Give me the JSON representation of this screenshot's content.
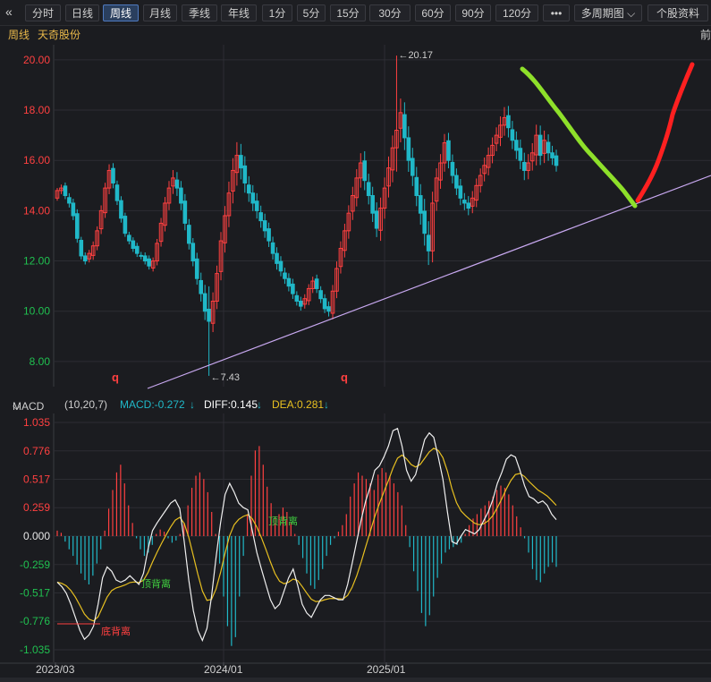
{
  "toolbar": {
    "back_icon": "double-chevron-left-icon",
    "tabs": [
      {
        "label": "分时",
        "active": false
      },
      {
        "label": "日线",
        "active": false
      },
      {
        "label": "周线",
        "active": true
      },
      {
        "label": "月线",
        "active": false
      },
      {
        "label": "季线",
        "active": false
      },
      {
        "label": "年线",
        "active": false
      },
      {
        "label": "1分",
        "active": false
      },
      {
        "label": "5分",
        "active": false
      },
      {
        "label": "15分",
        "active": false
      },
      {
        "label": "30分",
        "active": false
      },
      {
        "label": "60分",
        "active": false
      },
      {
        "label": "90分",
        "active": false
      },
      {
        "label": "120分",
        "active": false
      }
    ],
    "more_label": "•••",
    "multi_period_label": "多周期图",
    "stock_info_label": "个股资料"
  },
  "header": {
    "period": "周线",
    "stock_name": "天奇股份",
    "prev": "前"
  },
  "macd_header": {
    "name": "MACD",
    "params": "(10,20,7)",
    "macd": "MACD:-0.272",
    "diff": "DIFF:0.145",
    "dea": "DEA:0.281",
    "arrow": "↓"
  },
  "colors": {
    "up": "#ff4040",
    "down": "#20b8c8",
    "diff": "#f0f0f0",
    "dea": "#e8c020",
    "trend": "#c8a8f0",
    "green_marker": "#8ee02a",
    "red_marker": "#ff2020",
    "grid": "#2c2d33"
  },
  "chart_data": [
    {
      "type": "candlestick",
      "title": "",
      "yticks": [
        "20.00",
        "18.00",
        "16.00",
        "14.00",
        "12.00",
        "10.00",
        "8.00"
      ],
      "ylim": [
        7.0,
        20.6
      ],
      "grid": true,
      "high_label": "←20.17",
      "low_label": "←7.43",
      "markers": [
        "q",
        "q"
      ],
      "closes": [
        14.8,
        14.9,
        14.6,
        14.3,
        13.8,
        12.9,
        12.2,
        12.0,
        12.3,
        12.6,
        13.2,
        14.0,
        14.9,
        15.6,
        15.1,
        14.4,
        13.7,
        13.1,
        12.8,
        12.5,
        12.3,
        12.2,
        12.0,
        11.8,
        12.0,
        12.7,
        13.5,
        14.3,
        14.9,
        15.3,
        14.9,
        14.3,
        13.5,
        12.7,
        12.0,
        11.3,
        10.7,
        10.0,
        9.6,
        10.4,
        11.5,
        12.8,
        13.8,
        14.7,
        15.6,
        16.2,
        15.7,
        15.1,
        14.7,
        14.3,
        14.0,
        13.6,
        13.2,
        12.8,
        12.3,
        11.9,
        11.6,
        11.3,
        11.0,
        10.7,
        10.4,
        10.2,
        10.5,
        10.9,
        11.2,
        10.9,
        10.5,
        10.1,
        10.0,
        10.8,
        11.7,
        12.5,
        13.2,
        13.9,
        14.6,
        15.3,
        15.9,
        15.2,
        14.6,
        13.9,
        13.3,
        14.1,
        14.9,
        15.7,
        16.5,
        17.2,
        17.9,
        16.9,
        16.0,
        15.4,
        14.6,
        13.9,
        13.1,
        12.4,
        14.3,
        15.3,
        15.9,
        16.7,
        16.0,
        15.4,
        14.9,
        14.5,
        14.3,
        14.1,
        14.5,
        15.0,
        15.4,
        15.8,
        16.2,
        16.6,
        17.0,
        17.4,
        17.7,
        17.3,
        16.8,
        16.4,
        16.0,
        15.6,
        15.9,
        16.3,
        17.0,
        16.2,
        16.8,
        16.3,
        16.1,
        15.8
      ],
      "spans": [
        0.3,
        0.4,
        0.4,
        0.5,
        0.5,
        0.5,
        0.4,
        0.4,
        0.4,
        0.5,
        0.5,
        0.6,
        0.6,
        0.7,
        0.6,
        0.5,
        0.5,
        0.4,
        0.4,
        0.4,
        0.4,
        0.4,
        0.4,
        0.4,
        0.4,
        0.5,
        0.6,
        0.7,
        0.8,
        0.9,
        0.9,
        0.8,
        0.8,
        0.7,
        0.6,
        0.7,
        0.9,
        1.0,
        2.6,
        1.0,
        0.9,
        1.0,
        1.1,
        1.3,
        1.4,
        1.5,
        1.3,
        1.1,
        1.0,
        0.9,
        0.9,
        0.8,
        0.8,
        0.7,
        0.7,
        0.7,
        0.6,
        0.6,
        0.6,
        0.6,
        0.5,
        0.5,
        0.5,
        0.5,
        0.5,
        0.5,
        0.5,
        0.5,
        0.6,
        0.7,
        0.8,
        0.8,
        0.8,
        0.9,
        1.0,
        1.0,
        1.1,
        1.1,
        1.0,
        1.0,
        1.0,
        1.2,
        1.2,
        1.3,
        1.4,
        2.7,
        1.6,
        1.4,
        1.3,
        1.2,
        1.2,
        1.3,
        1.4,
        1.6,
        1.3,
        1.1,
        1.0,
        1.0,
        0.9,
        0.9,
        0.8,
        0.8,
        0.8,
        0.8,
        0.8,
        0.8,
        0.8,
        0.9,
        0.9,
        0.9,
        0.9,
        1.0,
        1.2,
        1.1,
        1.0,
        1.0,
        1.0,
        1.1,
        1.0,
        1.1,
        1.2,
        1.1,
        1.1,
        0.9,
        0.8,
        0.7
      ]
    },
    {
      "type": "macd",
      "params": "(10,20,7)",
      "yticks": [
        "1.035",
        "0.776",
        "0.517",
        "0.259",
        "0.000",
        "-0.259",
        "-0.517",
        "-0.776",
        "-1.035"
      ],
      "ylim": [
        -1.035,
        1.035
      ],
      "xticks": [
        "2023/03",
        "2024/01",
        "2025/01"
      ],
      "annotations": [
        {
          "text": "底背离",
          "color": "#ff4040"
        },
        {
          "text": "顶背离",
          "color": "#40d040"
        },
        {
          "text": "顶背离",
          "color": "#40d040"
        }
      ],
      "hist": [
        0.05,
        0.03,
        -0.05,
        -0.12,
        -0.18,
        -0.26,
        -0.34,
        -0.4,
        -0.44,
        -0.36,
        -0.25,
        -0.12,
        0.05,
        0.25,
        0.42,
        0.58,
        0.65,
        0.48,
        0.28,
        0.12,
        -0.02,
        -0.12,
        -0.18,
        -0.15,
        -0.08,
        0.02,
        0.06,
        0.04,
        -0.02,
        -0.06,
        -0.04,
        0.02,
        0.12,
        0.28,
        0.44,
        0.55,
        0.58,
        0.52,
        0.4,
        0.22,
        0.02,
        -0.25,
        -0.55,
        -0.82,
        -1.0,
        -0.92,
        -0.55,
        -0.18,
        0.2,
        0.55,
        0.78,
        0.82,
        0.65,
        0.45,
        0.3,
        0.18,
        0.2,
        0.26,
        0.22,
        0.12,
        0.02,
        -0.08,
        -0.2,
        -0.34,
        -0.45,
        -0.48,
        -0.4,
        -0.3,
        -0.18,
        -0.08,
        -0.02,
        0.04,
        0.1,
        0.2,
        0.36,
        0.48,
        0.58,
        0.55,
        0.52,
        0.48,
        0.42,
        0.56,
        0.62,
        0.58,
        0.55,
        0.48,
        0.4,
        0.28,
        0.1,
        -0.1,
        -0.32,
        -0.5,
        -0.7,
        -0.82,
        -0.72,
        -0.55,
        -0.38,
        -0.25,
        -0.15,
        -0.12,
        -0.1,
        -0.08,
        -0.06,
        0.02,
        0.1,
        0.16,
        0.2,
        0.25,
        0.28,
        0.32,
        0.36,
        0.42,
        0.46,
        0.44,
        0.38,
        0.28,
        0.18,
        0.08,
        -0.02,
        -0.15,
        -0.3,
        -0.4,
        -0.42,
        -0.34,
        -0.28,
        -0.24,
        -0.28
      ],
      "diff": [
        -0.42,
        -0.46,
        -0.52,
        -0.62,
        -0.74,
        -0.86,
        -0.94,
        -0.9,
        -0.82,
        -0.62,
        -0.38,
        -0.28,
        -0.32,
        -0.4,
        -0.42,
        -0.4,
        -0.36,
        -0.4,
        -0.44,
        -0.34,
        -0.12,
        0.05,
        0.12,
        0.18,
        0.24,
        0.3,
        0.33,
        0.25,
        -0.05,
        -0.4,
        -0.68,
        -0.86,
        -0.95,
        -0.84,
        -0.55,
        -0.2,
        0.12,
        0.38,
        0.48,
        0.4,
        0.3,
        0.26,
        0.24,
        0.05,
        -0.15,
        -0.3,
        -0.44,
        -0.58,
        -0.66,
        -0.62,
        -0.5,
        -0.38,
        -0.3,
        -0.45,
        -0.62,
        -0.7,
        -0.74,
        -0.66,
        -0.58,
        -0.54,
        -0.54,
        -0.56,
        -0.58,
        -0.58,
        -0.44,
        -0.25,
        -0.05,
        0.15,
        0.32,
        0.45,
        0.6,
        0.64,
        0.72,
        0.82,
        0.96,
        0.98,
        0.82,
        0.6,
        0.5,
        0.56,
        0.72,
        0.88,
        0.94,
        0.9,
        0.72,
        0.52,
        0.22,
        -0.05,
        -0.07,
        0.0,
        0.06,
        0.04,
        0.02,
        0.06,
        0.14,
        0.22,
        0.33,
        0.48,
        0.58,
        0.7,
        0.74,
        0.72,
        0.6,
        0.46,
        0.36,
        0.34,
        0.3,
        0.32,
        0.28,
        0.2,
        0.15
      ]
    }
  ]
}
